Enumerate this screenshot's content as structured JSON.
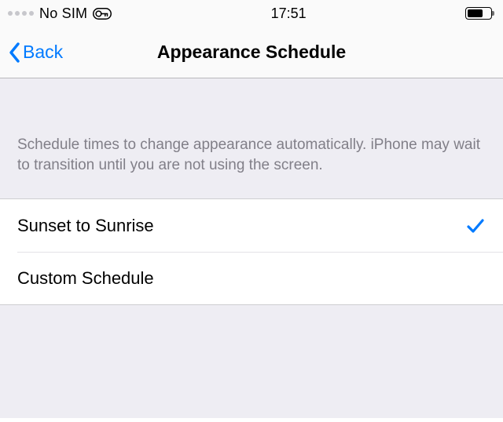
{
  "statusbar": {
    "carrier": "No SIM",
    "time": "17:51"
  },
  "nav": {
    "back_label": "Back",
    "title": "Appearance Schedule"
  },
  "hint": "Schedule times to change appearance automatically. iPhone may wait to transition until you are not using the screen.",
  "options": {
    "sunset": {
      "label": "Sunset to Sunrise",
      "selected": true
    },
    "custom": {
      "label": "Custom Schedule",
      "selected": false
    }
  }
}
